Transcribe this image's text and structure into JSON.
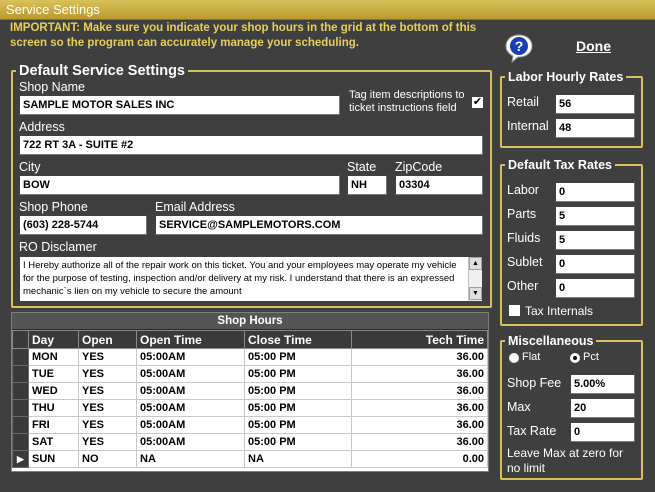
{
  "window": {
    "title": "Service Settings"
  },
  "notice": "IMPORTANT: Make sure you indicate your shop hours in the grid at the bottom of this screen so the program can accurately manage your scheduling.",
  "help_icon": "question-bubble-icon",
  "done_label": "Done",
  "defaults": {
    "legend": "Default Service Settings",
    "shop_name_label": "Shop Name",
    "shop_name": "SAMPLE MOTOR SALES INC",
    "tag_label": "Tag item descriptions to ticket instructions field",
    "tag_checked": "✔",
    "address_label": "Address",
    "address": "722 RT 3A - SUITE #2",
    "city_label": "City",
    "city": "BOW",
    "state_label": "State",
    "state": "NH",
    "zip_label": "ZipCode",
    "zip": "03304",
    "phone_label": "Shop Phone",
    "phone": "(603) 228-5744",
    "email_label": "Email Address",
    "email": "SERVICE@SAMPLEMOTORS.COM",
    "ro_label": "RO Disclamer",
    "ro_text": "I Hereby authorize all of the repair work on this ticket.  You and your employees may operate my vehicle for the purpose of testing, inspection and/or delivery at my risk. I understand that there is an expressed mechanic`s lien on my vehicle to secure the amount"
  },
  "shop_hours": {
    "title": "Shop Hours",
    "columns": [
      "Day",
      "Open",
      "Open Time",
      "Close Time",
      "Tech Time"
    ],
    "rows": [
      {
        "day": "MON",
        "open": "YES",
        "open_time": "05:00AM",
        "close_time": "05:00 PM",
        "tech_time": "36.00"
      },
      {
        "day": "TUE",
        "open": "YES",
        "open_time": "05:00AM",
        "close_time": "05:00 PM",
        "tech_time": "36.00"
      },
      {
        "day": "WED",
        "open": "YES",
        "open_time": "05:00AM",
        "close_time": "05:00 PM",
        "tech_time": "36.00"
      },
      {
        "day": "THU",
        "open": "YES",
        "open_time": "05:00AM",
        "close_time": "05:00 PM",
        "tech_time": "36.00"
      },
      {
        "day": "FRI",
        "open": "YES",
        "open_time": "05:00AM",
        "close_time": "05:00 PM",
        "tech_time": "36.00"
      },
      {
        "day": "SAT",
        "open": "YES",
        "open_time": "05:00AM",
        "close_time": "05:00 PM",
        "tech_time": "36.00"
      },
      {
        "day": "SUN",
        "open": "NO",
        "open_time": "NA",
        "close_time": "NA",
        "tech_time": "0.00"
      }
    ],
    "current_row_marker": "▶"
  },
  "labor": {
    "legend": "Labor Hourly Rates",
    "retail_label": "Retail",
    "retail": "56",
    "internal_label": "Internal",
    "internal": "48"
  },
  "tax": {
    "legend": "Default Tax Rates",
    "labor_label": "Labor",
    "labor": "0",
    "parts_label": "Parts",
    "parts": "5",
    "fluids_label": "Fluids",
    "fluids": "5",
    "sublet_label": "Sublet",
    "sublet": "0",
    "other_label": "Other",
    "other": "0",
    "tax_internals_label": "Tax Internals"
  },
  "misc": {
    "legend": "Miscellaneous",
    "flat_label": "Flat",
    "pct_label": "Pct",
    "selected": "Pct",
    "shop_fee_label": "Shop Fee",
    "shop_fee": "5.00%",
    "max_label": "Max",
    "max": "20",
    "tax_rate_label": "Tax Rate",
    "tax_rate": "0",
    "note": "Leave Max at zero for no limit"
  },
  "colors": {
    "accent": "#d9bf5e",
    "background": "#3f3f3f",
    "notice": "#e6cf5a"
  }
}
